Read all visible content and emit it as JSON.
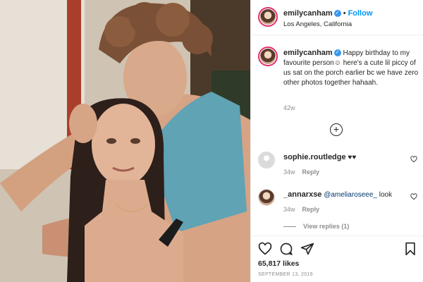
{
  "post": {
    "photo_alt": "",
    "author": {
      "username": "emilycanham",
      "verified": true,
      "follow_label": "Follow",
      "dot": "•",
      "location": "Los Angeles, California"
    },
    "caption": {
      "username": "emilycanham",
      "text": "Happy birthday to my favourite person☺ here's a cute lil piccy of us sat on the porch earlier bc we have zero other photos together hahaah.",
      "time": "42w"
    },
    "load_more_icon": "plus-circle-icon",
    "comments": [
      {
        "username": "sophie.routledge",
        "text": "♥♥",
        "time": "34w",
        "reply_label": "Reply",
        "mention": ""
      },
      {
        "username": "_annarxse",
        "mention": "@ameliaroseee_",
        "text": "look",
        "time": "34w",
        "reply_label": "Reply"
      }
    ],
    "view_replies": "View replies (1)",
    "actions": {
      "icons": [
        "heart-icon",
        "comment-icon",
        "share-icon",
        "bookmark-icon"
      ]
    },
    "likes": "65,817 likes",
    "date": "SEPTEMBER 13, 2019"
  },
  "colors": {
    "accent": "#0095f6",
    "verified": "#3897f0",
    "muted": "#8e8e8e",
    "text": "#262626"
  }
}
